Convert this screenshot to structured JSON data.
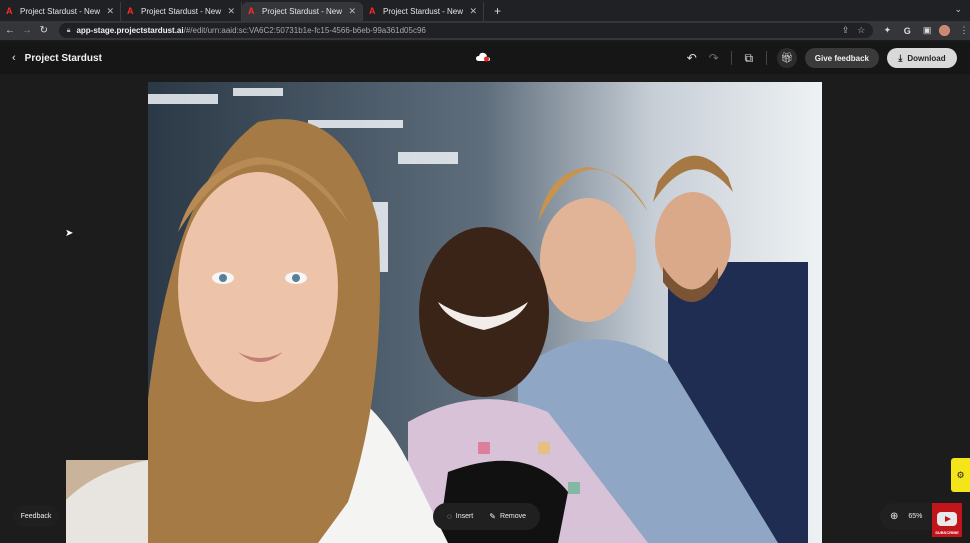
{
  "browser": {
    "tabs": [
      {
        "title": "Project Stardust - New Project",
        "active": false
      },
      {
        "title": "Project Stardust - New Project",
        "active": false
      },
      {
        "title": "Project Stardust - New Project",
        "active": true
      },
      {
        "title": "Project Stardust - New Project",
        "active": false
      }
    ],
    "url_host": "app-stage.projectstardust.ai",
    "url_path": "/#/edit/urn:aaid:sc:VA6C2:50731b1e-fc15-4566-b6eb-99a361d05c96"
  },
  "header": {
    "title": "Project Stardust",
    "feedback_label": "Give feedback",
    "download_label": "Download"
  },
  "toolbar": {
    "insert_label": "Insert",
    "remove_label": "Remove",
    "zoom_level": "65%"
  },
  "feedback_label": "Feedback",
  "subscribe_label": "SUBSCRIBE",
  "colors": {
    "accent_red": "#ff2a2a",
    "subscribe_red": "#c2141b",
    "badge_yellow": "#f4e51b"
  }
}
